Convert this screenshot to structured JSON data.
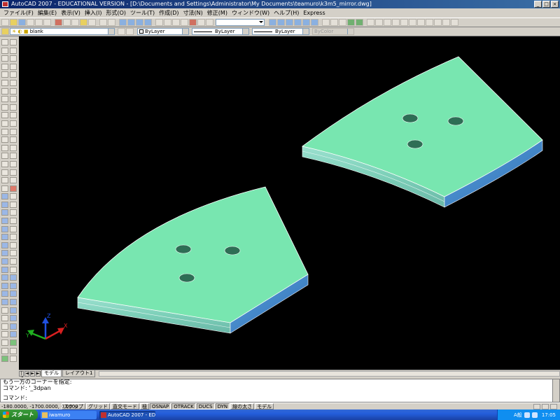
{
  "window": {
    "title": "AutoCAD 2007 - EDUCATIONAL VERSION - [D:\\Documents and Settings\\Administrator\\My Documents\\teamuro\\k3m5_mirror.dwg]"
  },
  "window_controls": {
    "minimize": "_",
    "maximize": "□",
    "close": "×"
  },
  "menu": [
    "ファイル(F)",
    "編集(E)",
    "表示(V)",
    "挿入(I)",
    "形式(O)",
    "ツール(T)",
    "作成(D)",
    "寸法(N)",
    "修正(M)",
    "ウィンドウ(W)",
    "ヘルプ(H)",
    "Express"
  ],
  "layer_toolbar": {
    "layer_name": "blank",
    "color": "ByLayer",
    "linetype": "ByLayer",
    "lineweight": "ByLayer",
    "plotstyle": "ByColor"
  },
  "ucs_icon": {
    "x": "X",
    "y": "Y",
    "z": "Z"
  },
  "layout_tabs": {
    "nav": [
      "|◄",
      "◄",
      "►",
      "►|"
    ],
    "tabs": [
      "モデル",
      "レイアウト1"
    ],
    "active": 0
  },
  "command_line": {
    "history": [
      "もう一方のコーナーを指定:",
      "コマンド: '_3dpan"
    ],
    "prompt": "コマンド:"
  },
  "status_bar": {
    "coordinates": "-180.0000, -1700.0000, 0.0000",
    "buttons": [
      "スナップ",
      "グリッド",
      "直交モード",
      "極",
      "OSNAP",
      "OTRACK",
      "DUCS",
      "DYN",
      "線の太さ",
      "モデル"
    ],
    "active_buttons": [
      "OSNAP",
      "OTRACK",
      "DUCS",
      "DYN"
    ]
  },
  "taskbar": {
    "start_label": "スタート",
    "tasks": [
      "iwamuro",
      "AutoCAD 2007 - ED..."
    ],
    "active_task": 1,
    "lang": "A般",
    "clock": "17:05"
  },
  "colors": {
    "viewport_bg": "#000000",
    "part_top": "#78e6b0",
    "part_side": "#7ccfb8",
    "part_side_dark": "#3d82c8",
    "edge": "#ffffff",
    "axis_x": "#d82020",
    "axis_y": "#20b020",
    "axis_z": "#2050e0"
  },
  "icons": [
    "new-icon",
    "open-icon",
    "save-icon",
    "print-icon",
    "cut-icon",
    "copy-icon",
    "paste-icon",
    "undo-icon",
    "redo-icon",
    "pan-icon",
    "zoom-icon",
    "properties-icon",
    "layer-icon"
  ]
}
